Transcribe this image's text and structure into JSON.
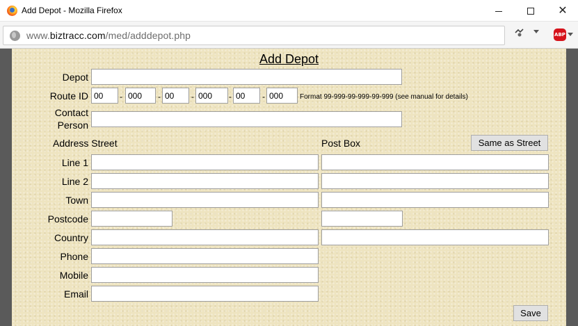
{
  "window": {
    "title": "Add Depot - Mozilla Firefox",
    "minimize_glyph": "",
    "close_glyph": "✕"
  },
  "browser": {
    "url_prefix": "www.",
    "url_domain": "biztracc.com",
    "url_path": "/med/adddepot.php",
    "abp_label": "ABP"
  },
  "form": {
    "heading": "Add Depot",
    "depot_label": "Depot",
    "depot_value": "",
    "route_label": "Route ID",
    "route_parts": [
      "00",
      "000",
      "00",
      "000",
      "00",
      "000"
    ],
    "route_sep": "-",
    "route_format": "Format 99-999-99-999-99-999 (see manual for details)",
    "contact_label_line1": "Contact",
    "contact_label_line2": "Person",
    "contact_value": "",
    "address_street_label": "Address Street",
    "post_box_label": "Post Box",
    "same_as_street_label": "Same as Street",
    "line1_label": "Line 1",
    "line2_label": "Line 2",
    "town_label": "Town",
    "postcode_label": "Postcode",
    "country_label": "Country",
    "phone_label": "Phone",
    "mobile_label": "Mobile",
    "email_label": "Email",
    "save_label": "Save"
  }
}
